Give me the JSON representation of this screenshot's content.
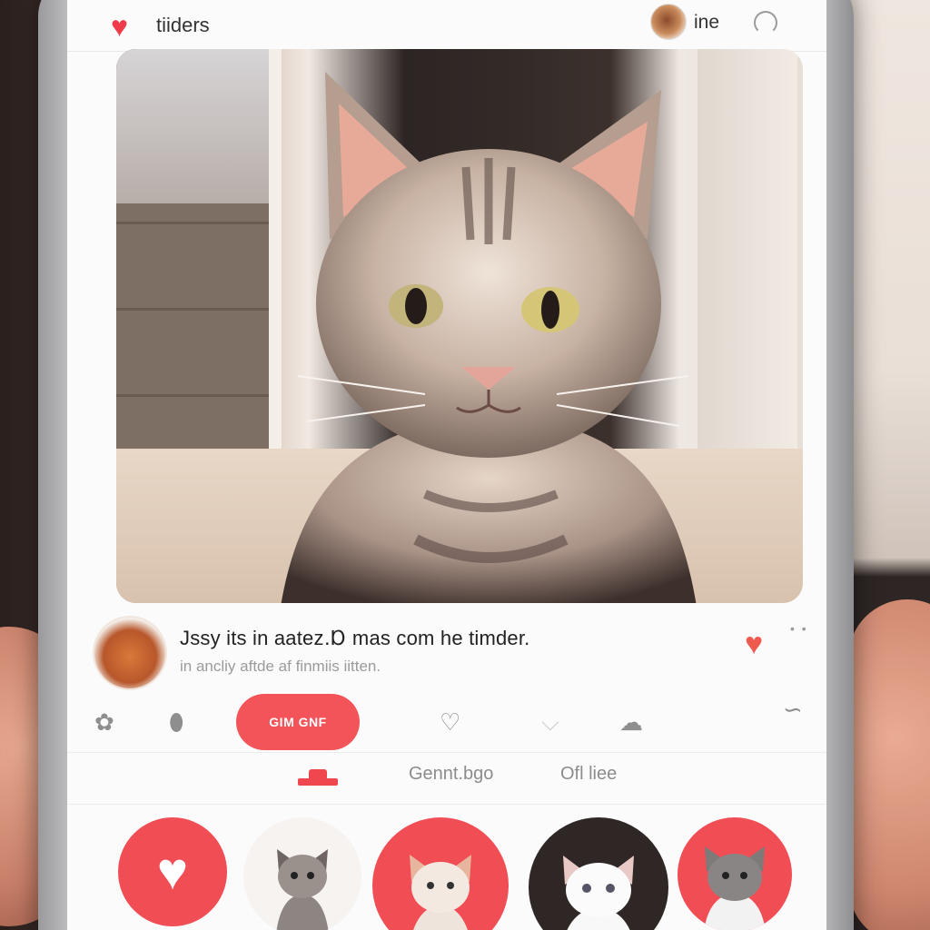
{
  "app": {
    "name": "tiiders",
    "user": "ine"
  },
  "post": {
    "caption_title": "Jssy its in aatez․Ɒ mas com he timder.",
    "caption_sub": "in ancliy aftde af finmiis iitten.",
    "more_label": "• •"
  },
  "actions": {
    "cta_label": "GIM GNF"
  },
  "tabs": [
    {
      "label": "Gennt.bgo"
    },
    {
      "label": "Ofl liee"
    }
  ],
  "icons": {
    "logo": "heart-icon",
    "loading": "refresh-icon",
    "like": "heart-icon",
    "action_1": "paw-icon",
    "action_2": "pin-icon",
    "action_3": "heart-outline-icon",
    "action_4": "chevron-down-icon",
    "action_5": "cat-face-icon",
    "action_6": "tail-icon"
  },
  "colors": {
    "accent": "#f2545a",
    "heart": "#ef3b4a"
  }
}
